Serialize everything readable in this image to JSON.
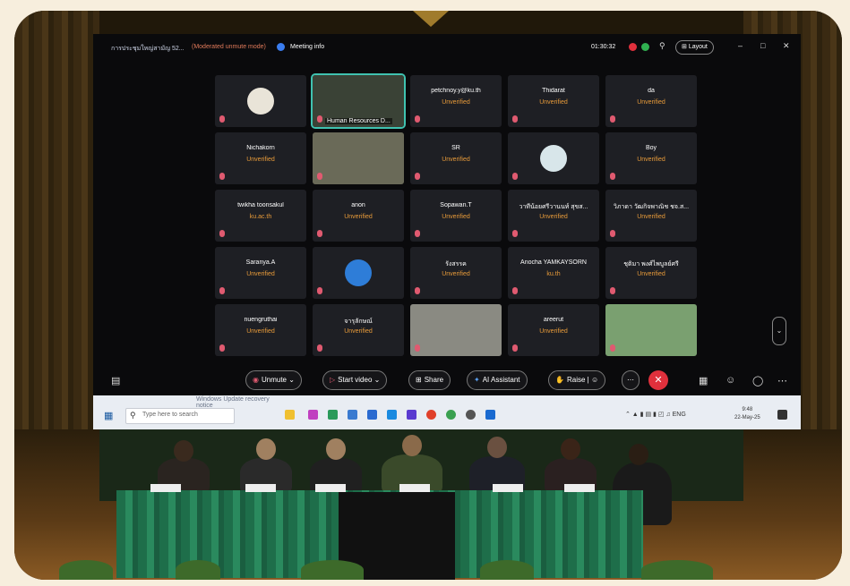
{
  "meeting": {
    "title": "การประชุมใหญ่สามัญ 52...",
    "mode": "(Moderated unmute mode)",
    "info_label": "Meeting info",
    "timer": "01:30:32",
    "layout_label": "Layout"
  },
  "tiles": [
    {
      "type": "avatar",
      "color": "#e9e4d8"
    },
    {
      "type": "video",
      "caption": "Human Resources D...",
      "color": "#3a4236"
    },
    {
      "type": "text",
      "name": "petchnoy.y@ku.th",
      "status": "Unverified"
    },
    {
      "type": "text",
      "name": "Thidarat",
      "status": "Unverified"
    },
    {
      "type": "text",
      "name": "da",
      "status": "Unverified"
    },
    {
      "type": "text",
      "name": "Nichakorn",
      "status": "Unverified"
    },
    {
      "type": "video",
      "caption": "",
      "color": "#6a6a58"
    },
    {
      "type": "text",
      "name": "SR",
      "status": "Unverified"
    },
    {
      "type": "avatar",
      "color": "#d8e6ea"
    },
    {
      "type": "text",
      "name": "Boy",
      "status": "Unverified"
    },
    {
      "type": "text",
      "name": "twikha toonsakul",
      "status": "ku.ac.th"
    },
    {
      "type": "text",
      "name": "anon",
      "status": "Unverified"
    },
    {
      "type": "text",
      "name": "Sopawan.T",
      "status": "Unverified"
    },
    {
      "type": "text",
      "name": "วาทีน้อยศรีวานนท์ สุขส...",
      "status": "Unverified"
    },
    {
      "type": "text",
      "name": "วิภาดา วัฒกิจพาณิช ชจ.ส...",
      "status": "Unverified"
    },
    {
      "type": "text",
      "name": "Saranya.A",
      "status": "Unverified"
    },
    {
      "type": "avatar",
      "color": "#2e7dd8"
    },
    {
      "type": "text",
      "name": "รังสรรค",
      "status": "Unverified"
    },
    {
      "type": "text",
      "name": "Anocha YAMKAYSORN",
      "status": "ku.th"
    },
    {
      "type": "text",
      "name": "ชุติมา พงศ์ไพบูลย์ศรี",
      "status": "Unverified"
    },
    {
      "type": "text",
      "name": "nuengruthai",
      "status": "Unverified"
    },
    {
      "type": "text",
      "name": "จารุลักษณ์",
      "status": "Unverified"
    },
    {
      "type": "video",
      "caption": "",
      "color": "#8a8a82"
    },
    {
      "type": "text",
      "name": "areerut",
      "status": "Unverified"
    },
    {
      "type": "video",
      "caption": "",
      "color": "#7aa070"
    }
  ],
  "controls": {
    "unmute": "Unmute",
    "start_video": "Start video",
    "share": "Share",
    "ai_assistant": "AI Assistant",
    "raise": "Raise"
  },
  "taskbar": {
    "update_notice": "Windows Update recovery",
    "update_sub": "notice",
    "search_placeholder": "Type here to search",
    "tray_text": "ENG",
    "clock_time": "9:48",
    "clock_date": "22-May-25"
  },
  "colors": {
    "unverified": "#e89b3a",
    "end_call": "#e0303c",
    "table_cloth": "#1e6e4a"
  }
}
